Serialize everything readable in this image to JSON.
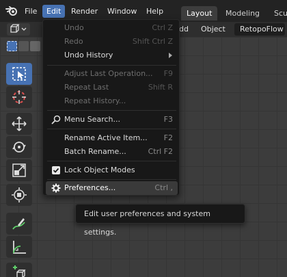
{
  "topbar": {
    "menus": [
      "File",
      "Edit",
      "Render",
      "Window",
      "Help"
    ],
    "workspaces": [
      "Layout",
      "Modeling",
      "Scu"
    ]
  },
  "header": {
    "add_label": "dd",
    "object_label": "Object",
    "retopoflow_label": "RetopoFlow"
  },
  "edit_menu": {
    "items": [
      {
        "label": "Undo",
        "shortcut": "Ctrl Z",
        "enabled": false
      },
      {
        "label": "Redo",
        "shortcut": "Shift Ctrl Z",
        "enabled": false
      },
      {
        "label": "Undo History",
        "shortcut": "",
        "enabled": true,
        "submenu": true
      },
      {
        "label": "Adjust Last Operation...",
        "shortcut": "F9",
        "enabled": false
      },
      {
        "label": "Repeat Last",
        "shortcut": "Shift R",
        "enabled": false
      },
      {
        "label": "Repeat History...",
        "shortcut": "",
        "enabled": false
      },
      {
        "label": "Menu Search...",
        "shortcut": "F3",
        "enabled": true,
        "icon": "search-icon"
      },
      {
        "label": "Rename Active Item...",
        "shortcut": "F2",
        "enabled": true
      },
      {
        "label": "Batch Rename...",
        "shortcut": "Ctrl F2",
        "enabled": true
      },
      {
        "label": "Lock Object Modes",
        "shortcut": "",
        "enabled": true,
        "icon": "checkbox-checked-icon",
        "checked": true
      },
      {
        "label": "Preferences...",
        "shortcut": "Ctrl ,",
        "enabled": true,
        "icon": "gear-icon",
        "hovered": true
      }
    ]
  },
  "tooltip": {
    "text": "Edit user preferences and system settings."
  },
  "toolbar": {
    "tools": [
      "select-box-icon",
      "cursor-icon",
      "move-icon",
      "rotate-icon",
      "scale-icon",
      "transform-icon",
      "annotate-icon",
      "measure-icon",
      "add-cube-icon"
    ],
    "active": "select-box-icon"
  },
  "colors": {
    "accent": "#4772b3",
    "menu_bg": "#181818",
    "topbar_bg": "#232323"
  }
}
